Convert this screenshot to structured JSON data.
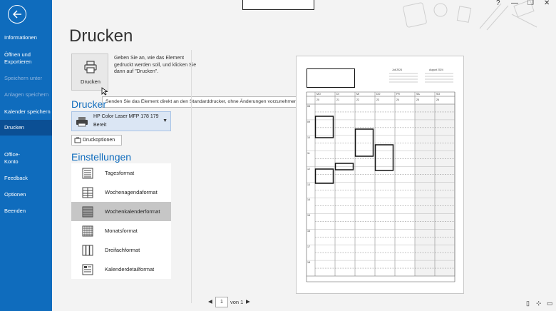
{
  "sidebar": {
    "items": [
      {
        "label": "Informationen",
        "state": "normal"
      },
      {
        "label": "Öffnen und Exportieren",
        "state": "normal"
      },
      {
        "label": "Speichern unter",
        "state": "disabled"
      },
      {
        "label": "Anlagen speichern",
        "state": "disabled"
      },
      {
        "label": "Kalender speichern",
        "state": "normal"
      },
      {
        "label": "Drucken",
        "state": "selected"
      },
      {
        "label": "Office-Konto",
        "state": "normal"
      },
      {
        "label": "Feedback",
        "state": "normal"
      },
      {
        "label": "Optionen",
        "state": "normal"
      },
      {
        "label": "Beenden",
        "state": "normal"
      }
    ]
  },
  "page": {
    "title": "Drucken",
    "print_button_label": "Drucken",
    "print_description": "Geben Sie an, wie das Element gedruckt werden soll, und klicken Sie dann auf \"Drucken\".",
    "tooltip": "Senden Sie das Element direkt an den Standarddrucker, ohne Änderungen vorzunehmen."
  },
  "printer": {
    "section_title": "Drucker",
    "name": "HP Color Laser MFP 178 179",
    "status": "Bereit",
    "options_label": "Druckoptionen"
  },
  "settings": {
    "section_title": "Einstellungen",
    "formats": [
      {
        "label": "Tagesformat",
        "selected": false
      },
      {
        "label": "Wochenagendaformat",
        "selected": false
      },
      {
        "label": "Wochenkalenderformat",
        "selected": true
      },
      {
        "label": "Monatsformat",
        "selected": false
      },
      {
        "label": "Dreifachformat",
        "selected": false
      },
      {
        "label": "Kalenderdetailformat",
        "selected": false
      }
    ]
  },
  "preview": {
    "mini_month_1": "Juli 2024",
    "mini_month_2": "August 2024",
    "days": [
      "MO",
      "DI",
      "MI",
      "DO",
      "FR",
      "SA",
      "SO"
    ],
    "dates": [
      "20",
      "21",
      "22",
      "23",
      "24",
      "25",
      "26"
    ],
    "hours": [
      "08",
      "09",
      "10",
      "11",
      "12",
      "13",
      "14",
      "15",
      "16",
      "17",
      "18"
    ]
  },
  "pager": {
    "current_page": "1",
    "of_label": "von 1"
  },
  "window": {
    "help": "?",
    "minimize": "—",
    "restore": "❐",
    "close": "✕"
  },
  "colors": {
    "sidebar": "#0f6cbd",
    "sidebar_selected": "#0b4f94",
    "accent": "#0f6cbd"
  }
}
